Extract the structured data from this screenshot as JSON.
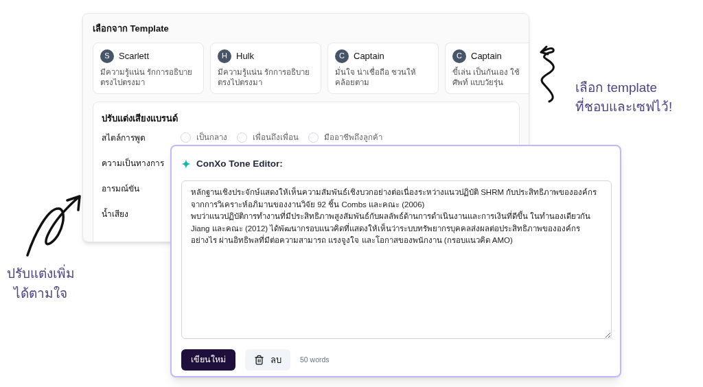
{
  "template_panel": {
    "title": "เลือกจาก Template",
    "templates": [
      {
        "initial": "S",
        "name": "Scarlett",
        "description": "มีความรู้แน่น รักการอธิบาย ตรงไปตรงมา"
      },
      {
        "initial": "H",
        "name": "Hulk",
        "description": "มีความรู้แน่น รักการอธิบาย ตรงไปตรงมา"
      },
      {
        "initial": "C",
        "name": "Captain",
        "description": "มั่นใจ น่าเชื่อถือ ชวนให้คล้อยตาม"
      },
      {
        "initial": "C",
        "name": "Captain",
        "description": "ขี้เล่น เป็นกันเอง ใช้ศัพท์ แบบวัยรุ่น"
      }
    ],
    "brand_voice": {
      "title": "ปรับแต่งเสียงแบรนด์",
      "rows": [
        {
          "label": "สไตล์การพูด",
          "options": [
            {
              "label": "เป็นกลาง",
              "selected": false
            },
            {
              "label": "เพื่อนถึงเพื่อน",
              "selected": false
            },
            {
              "label": "มืออาชีพถึงลูกค้า",
              "selected": false
            }
          ]
        },
        {
          "label": "ความเป็นทางการ"
        },
        {
          "label": "อารมณ์ขัน"
        },
        {
          "label": "น้ำเสียง"
        }
      ]
    }
  },
  "editor": {
    "title": "ConXo Tone Editor:",
    "text": "หลักฐานเชิงประจักษ์แสดงให้เห็นความสัมพันธ์เชิงบวกอย่างต่อเนื่องระหว่างแนวปฏิบัติ SHRM กับประสิทธิภาพขององค์กร จากการวิเคราะห์อภิมานของงานวิจัย 92 ชิ้น Combs และคณะ (2006)\nพบว่าแนวปฏิบัติการทำงานที่มีประสิทธิภาพสูงสัมพันธ์กับผลลัพธ์ด้านการดำเนินงานและการเงินที่ดีขึ้น ในทำนองเดียวกัน Jiang และคณะ (2012) ได้พัฒนากรอบแนวคิดที่แสดงให้เห็นว่าระบบทรัพยากรบุคคลส่งผลต่อประสิทธิภาพขององค์กรอย่างไร ผ่านอิทธิพลที่มีต่อความสามารถ แรงจูงใจ และโอกาสของพนักงาน (กรอบแนวคิด AMO)",
    "rewrite_button": "เขียนใหม่",
    "delete_button": "ลบ",
    "word_count": "50 words"
  },
  "annotations": [
    {
      "lines": [
        "เลือก template",
        "ที่ชอบและเซฟไว้!"
      ]
    },
    {
      "lines": [
        "ปรับแต่งเพิ่ม",
        "ได้ตามใจ"
      ]
    }
  ]
}
